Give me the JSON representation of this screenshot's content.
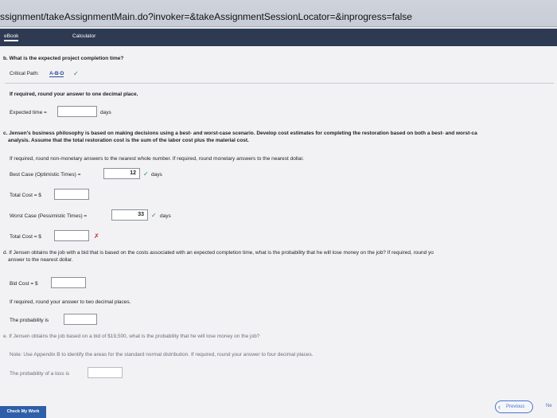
{
  "browser": {
    "url": "ssignment/takeAssignmentMain.do?invoker=&takeAssignmentSessionLocator=&inprogress=false"
  },
  "tabs": {
    "ebook": "eBook",
    "calculator": "Calculator"
  },
  "part_b": {
    "question": "b.  What is the expected project completion time?",
    "critical_path_label": "Critical Path:",
    "critical_path_value": "A-B-D",
    "critical_path_check": "✓",
    "rounding_note": "If required, round your answer to one decimal place.",
    "expected_time_label": "Expected time =",
    "expected_time_value": "",
    "expected_time_unit": "days"
  },
  "part_c": {
    "intro_line1": "c.  Jensen's business philosophy is based on making decisions using a best- and worst-case scenario. Develop cost estimates for completing the restoration based on both a best- and worst-ca",
    "intro_line2": "analysis. Assume that the total restoration cost is the sum of the labor cost plus the material cost.",
    "rounding_note": "If required, round non-monetary answers to the nearest whole number. If required, round monetary answers to the nearest dollar.",
    "best_case_label": "Best Case (Optimistic Times) =",
    "best_case_value": "12",
    "best_case_check": "✓",
    "best_case_unit": "days",
    "total_cost_label_1": "Total Cost = $",
    "total_cost_value_1": "",
    "worst_case_label": "Worst Case (Pessimistic Times) =",
    "worst_case_value": "33",
    "worst_case_check": "✓",
    "worst_case_unit": "days",
    "total_cost_label_2": "Total Cost = $",
    "total_cost_value_2": "",
    "total_cost_mark_2": "✗"
  },
  "part_d": {
    "intro_line1": "d.  If Jensen obtains the job with a bid that is based on the costs associated with an expected completion time, what is the probability that he will lose money on the job? If required, round yo",
    "intro_line2": "answer to the nearest dollar.",
    "bid_cost_label": "Bid Cost = $",
    "bid_cost_value": "",
    "rounding_note": "If required, round your answer to two decimal places.",
    "probability_label": "The probability is",
    "probability_value": ""
  },
  "part_e": {
    "question": "e.  If Jensen obtains the job based on a bid of $19,500, what is the probability that he will lose money on the job?",
    "note": "Note: Use Appendix B to identify the areas for the standard normal distribution. If required, round your answer to four decimal places.",
    "probability_label": "The probability of a loss is",
    "probability_value": ""
  },
  "footer": {
    "check_button": "Check My Work",
    "previous_button": "Previous",
    "next_button": "Ne"
  },
  "colors": {
    "accent": "#2e5fa8",
    "correct": "#2a8a3a",
    "incorrect": "#c42a2a",
    "tabbar": "#2d3a52"
  }
}
